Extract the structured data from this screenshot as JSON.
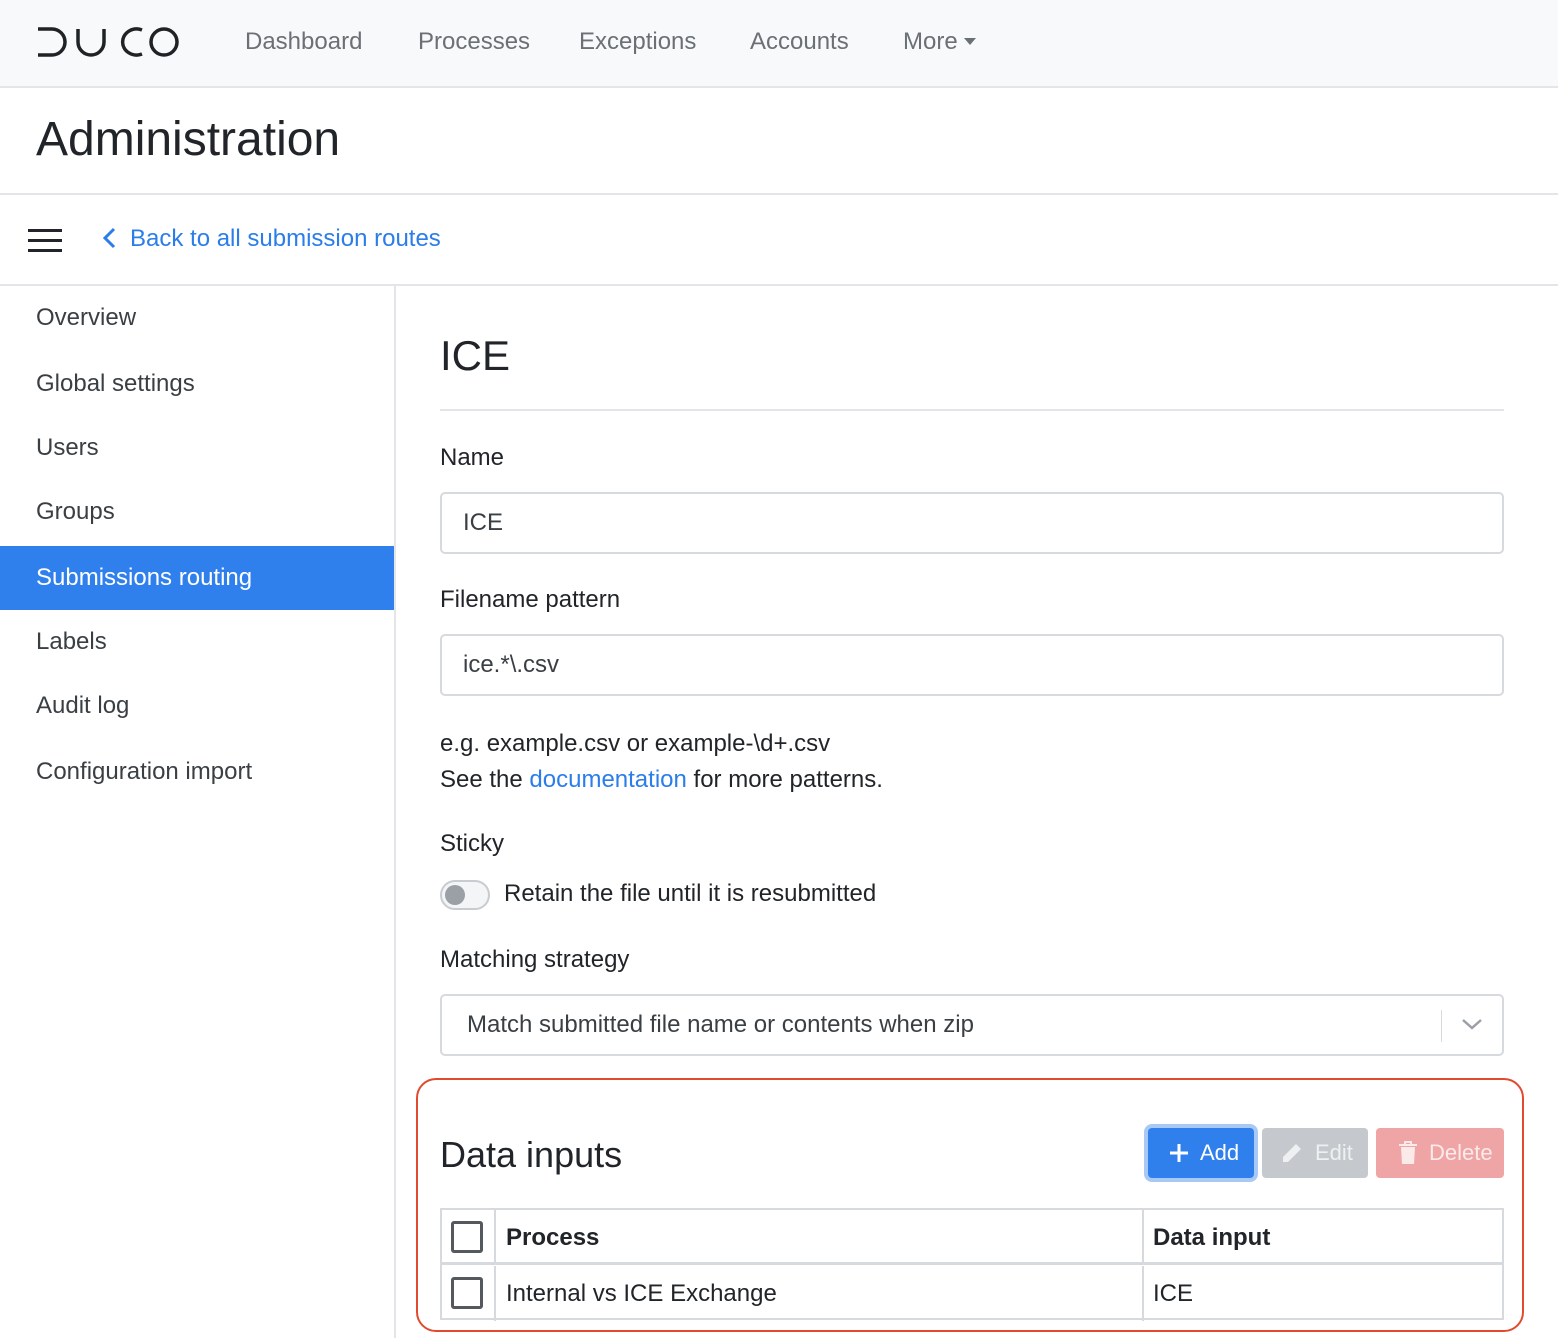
{
  "app": {
    "logo_text": "DUCO",
    "nav": [
      "Dashboard",
      "Processes",
      "Exceptions",
      "Accounts",
      "More"
    ]
  },
  "header": {
    "title": "Administration"
  },
  "subheader": {
    "back_link": "Back to all submission routes"
  },
  "sidebar": {
    "items": [
      {
        "label": "Overview"
      },
      {
        "label": "Global settings"
      },
      {
        "label": "Users"
      },
      {
        "label": "Groups"
      },
      {
        "label": "Submissions routing",
        "active": true
      },
      {
        "label": "Labels"
      },
      {
        "label": "Audit log"
      },
      {
        "label": "Configuration import"
      }
    ]
  },
  "form": {
    "title": "ICE",
    "name_label": "Name",
    "name_value": "ICE",
    "pattern_label": "Filename pattern",
    "pattern_value": "ice.*\\.csv",
    "help_line1": "e.g. example.csv or example-\\d+.csv",
    "help_prefix": "See the ",
    "help_link": "documentation",
    "help_suffix": " for more patterns.",
    "sticky_label": "Sticky",
    "sticky_toggle_label": "Retain the file until it is resubmitted",
    "sticky_on": false,
    "matching_label": "Matching strategy",
    "matching_value": "Match submitted file name or contents when zip"
  },
  "data_inputs": {
    "title": "Data inputs",
    "buttons": {
      "add": "Add",
      "edit": "Edit",
      "delete": "Delete"
    },
    "columns": [
      "Process",
      "Data input"
    ],
    "rows": [
      {
        "process": "Internal vs ICE Exchange",
        "data_input": "ICE"
      }
    ]
  },
  "colors": {
    "accent": "#2f80ed",
    "link": "#2b7de9",
    "highlight_border": "#e04b2f",
    "delete_disabled": "#efa5a5",
    "edit_disabled": "#c5c8cc"
  },
  "icons": [
    "logo",
    "caret-down-icon",
    "hamburger-icon",
    "chevron-left-icon",
    "chevron-down-icon",
    "plus-icon",
    "pencil-icon",
    "trash-icon",
    "checkbox-icon"
  ]
}
